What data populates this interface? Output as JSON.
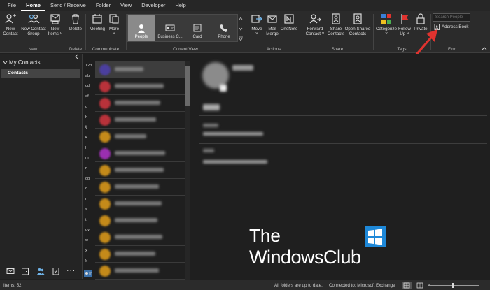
{
  "menu": {
    "tabs": [
      "File",
      "Home",
      "Send / Receive",
      "Folder",
      "View",
      "Developer",
      "Help"
    ],
    "active": "Home"
  },
  "ribbon": {
    "new_contact": "New\nContact",
    "new_contact_group": "New Contact\nGroup",
    "new_items": "New\nItems ˅",
    "delete": "Delete",
    "meeting": "Meeting",
    "more": "More\n˅",
    "view_people": "People",
    "view_business": "Business C...",
    "view_card": "Card",
    "view_phone": "Phone",
    "move": "Move\n˅",
    "mail_merge": "Mail\nMerge",
    "onenote": "OneNote",
    "forward_contact": "Forward\nContact ˅",
    "share_contacts": "Share\nContacts",
    "open_shared": "Open Shared\nContacts",
    "categorize": "Categorize\n˅",
    "follow_up": "Follow\nUp ˅",
    "private": "Private",
    "search_placeholder": "Search People",
    "address_book": "Address Book",
    "group_new": "New",
    "group_delete": "Delete",
    "group_communicate": "Communicate",
    "group_current_view": "Current View",
    "group_actions": "Actions",
    "group_share": "Share",
    "group_tags": "Tags",
    "group_find": "Find"
  },
  "folders": {
    "header": "My Contacts",
    "selected": "Contacts"
  },
  "index_letters": [
    "123",
    "ab",
    "cd",
    "ef",
    "g",
    "h",
    "ij",
    "k",
    "l",
    "m",
    "n",
    "op",
    "q",
    "r",
    "s",
    "t",
    "uv",
    "w",
    "x",
    "y",
    "z"
  ],
  "contacts": {
    "avatar_colors": [
      "#4b3f9e",
      "#b8323a",
      "#b8323a",
      "#b8323a",
      "#c48a1a",
      "#9a2fb0",
      "#c48a1a",
      "#c48a1a",
      "#c48a1a",
      "#c48a1a",
      "#c48a1a",
      "#c48a1a",
      "#c48a1a"
    ],
    "name_widths": [
      0.45,
      0.78,
      0.72,
      0.66,
      0.5,
      0.8,
      0.78,
      0.7,
      0.74,
      0.68,
      0.76,
      0.64,
      0.7
    ]
  },
  "status": {
    "items": "Items: 52",
    "sync": "All folders are up to date.",
    "connection": "Connected to: Microsoft Exchange"
  },
  "watermark": {
    "line1": "The",
    "line2": "WindowsClub"
  },
  "colors": {
    "accent_red": "#e0332f",
    "selected_view": "#8a8a8a"
  }
}
